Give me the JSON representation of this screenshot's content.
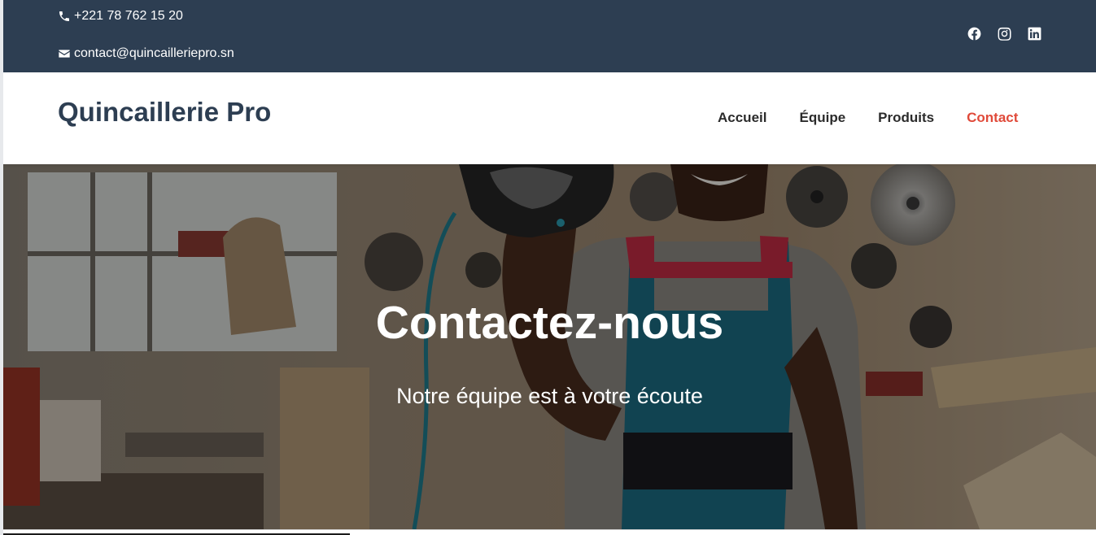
{
  "topbar": {
    "phone": "+221 78 762 15 20",
    "email": "contact@quincailleriepro.sn",
    "phone_icon": "phone-icon",
    "email_icon": "envelope-icon",
    "social": [
      "facebook-icon",
      "instagram-icon",
      "linkedin-icon"
    ]
  },
  "header": {
    "logo": "Quincaillerie Pro",
    "nav": [
      {
        "label": "Accueil",
        "active": false
      },
      {
        "label": "Équipe",
        "active": false
      },
      {
        "label": "Produits",
        "active": false
      },
      {
        "label": "Contact",
        "active": true
      }
    ]
  },
  "hero": {
    "title": "Contactez-nous",
    "subtitle": "Notre équipe est à votre écoute"
  },
  "colors": {
    "topbar_bg": "#2d3e52",
    "logo": "#2d3e52",
    "nav_text": "#2b2b2b",
    "nav_active": "#e04a3a"
  }
}
